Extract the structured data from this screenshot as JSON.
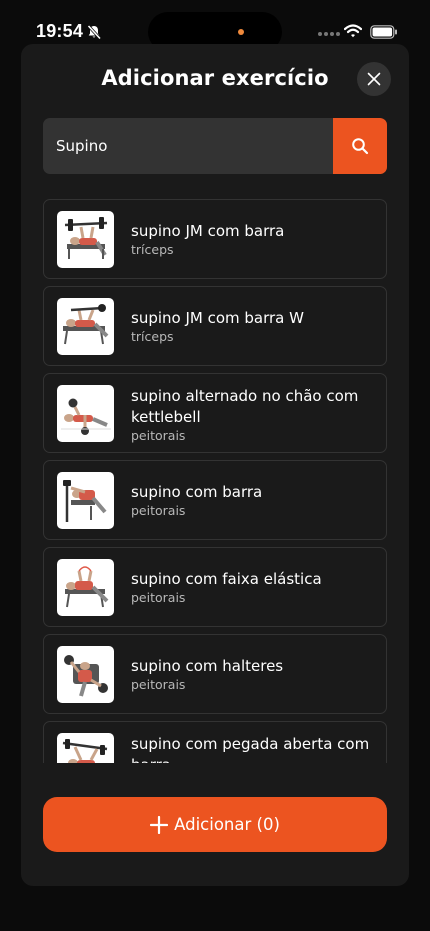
{
  "status_bar": {
    "time": "19:54",
    "icons": [
      "bell-off-icon",
      "cellular-icon",
      "wifi-icon",
      "battery-icon"
    ]
  },
  "modal": {
    "title": "Adicionar exercício",
    "close_icon": "close-icon"
  },
  "search": {
    "value": "Supino",
    "button_icon": "search-icon"
  },
  "results": [
    {
      "name": "supino JM com barra",
      "muscle": "tríceps"
    },
    {
      "name": "supino JM com barra W",
      "muscle": "tríceps"
    },
    {
      "name": "supino alternado no chão com kettlebell",
      "muscle": "peitorais"
    },
    {
      "name": "supino com barra",
      "muscle": "peitorais"
    },
    {
      "name": "supino com faixa elástica",
      "muscle": "peitorais"
    },
    {
      "name": "supino com halteres",
      "muscle": "peitorais"
    },
    {
      "name": "supino com pegada aberta com barra",
      "muscle": ""
    }
  ],
  "footer": {
    "add_label": "Adicionar (0)",
    "add_icon": "plus-icon"
  },
  "colors": {
    "accent": "#ec5420",
    "background": "#0b0b0b",
    "modal": "#1a1a1a",
    "input": "#333333"
  }
}
